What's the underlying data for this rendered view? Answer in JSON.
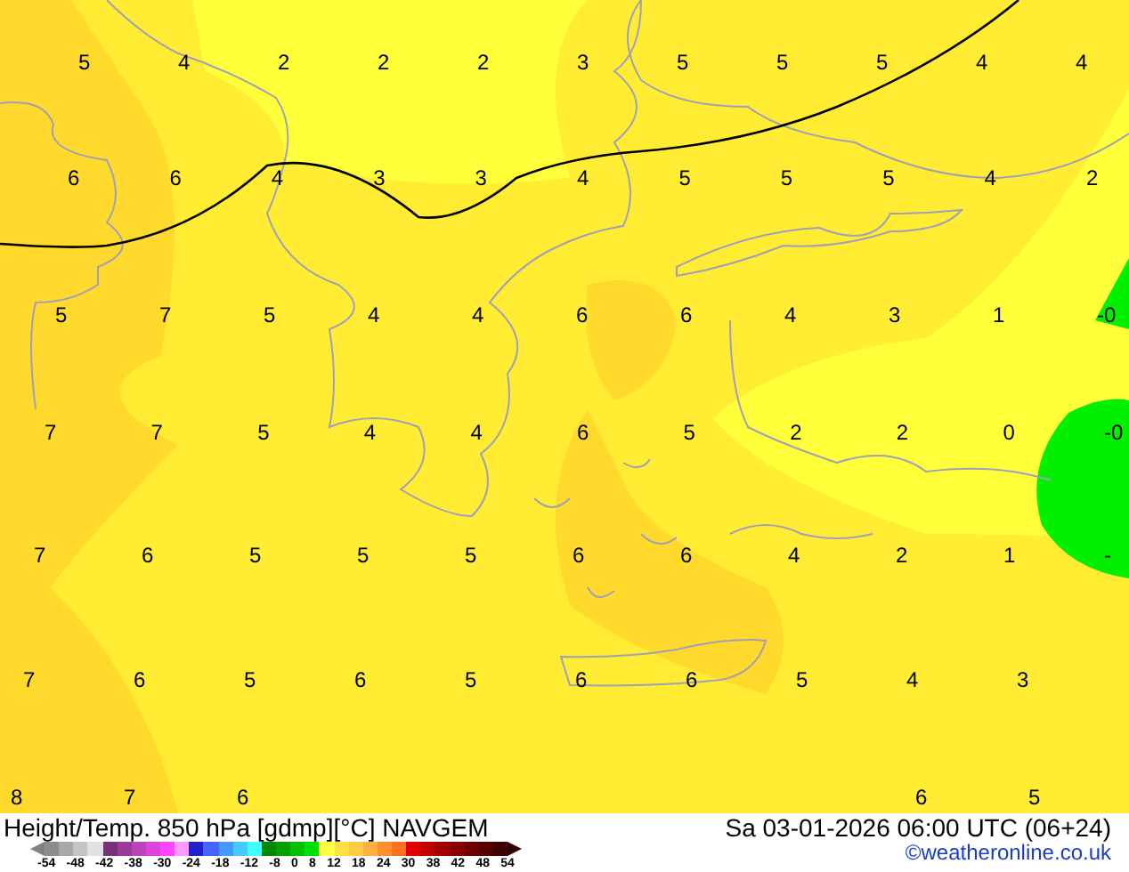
{
  "map": {
    "grid_rows": [
      [
        "5",
        "4",
        "2",
        "2",
        "2",
        "3",
        "5",
        "5",
        "5",
        "4",
        "4"
      ],
      [
        "6",
        "6",
        "4",
        "3",
        "3",
        "4",
        "5",
        "5",
        "5",
        "4",
        "2"
      ],
      [
        "5",
        "7",
        "5",
        "4",
        "4",
        "6",
        "6",
        "4",
        "3",
        "1",
        "-0"
      ],
      [
        "7",
        "7",
        "5",
        "4",
        "4",
        "6",
        "5",
        "2",
        "2",
        "0",
        "-0"
      ],
      [
        "7",
        "6",
        "5",
        "5",
        "5",
        "6",
        "6",
        "4",
        "2",
        "1",
        "-"
      ],
      [
        "7",
        "6",
        "5",
        "6",
        "5",
        "6",
        "6",
        "5",
        "4",
        "3"
      ],
      [
        "8",
        "7",
        "6",
        null,
        null,
        null,
        null,
        null,
        "6",
        "5"
      ]
    ]
  },
  "footer": {
    "title": "Height/Temp. 850 hPa [gdmp][°C] NAVGEM",
    "datetime": "Sa 03-01-2026 06:00 UTC (06+24)",
    "credit": "©weatheronline.co.uk",
    "legend": {
      "swatches": [
        {
          "color": "#8c8c8c"
        },
        {
          "color": "#a8a8a8"
        },
        {
          "color": "#c4c4c4"
        },
        {
          "color": "#e0e0e0"
        },
        {
          "color": "#7a2f7a"
        },
        {
          "color": "#9a3a9a"
        },
        {
          "color": "#bb44bb"
        },
        {
          "color": "#dd44dd"
        },
        {
          "color": "#ff44ff"
        },
        {
          "color": "#ff99ff"
        },
        {
          "color": "#2222cc"
        },
        {
          "color": "#4466ff"
        },
        {
          "color": "#4499ff"
        },
        {
          "color": "#44ccff"
        },
        {
          "color": "#44ffff"
        },
        {
          "color": "#008800"
        },
        {
          "color": "#00a000"
        },
        {
          "color": "#00c000"
        },
        {
          "color": "#00e000"
        },
        {
          "color": "#ffff44"
        },
        {
          "color": "#ffe044"
        },
        {
          "color": "#ffcc44"
        },
        {
          "color": "#ffb040"
        },
        {
          "color": "#ff9030"
        },
        {
          "color": "#ff7020"
        },
        {
          "color": "#e00000"
        },
        {
          "color": "#c00000"
        },
        {
          "color": "#a00000"
        },
        {
          "color": "#880000"
        },
        {
          "color": "#700000"
        },
        {
          "color": "#580000"
        },
        {
          "color": "#400000"
        }
      ],
      "labels": [
        "-54",
        "-48",
        "-42",
        "-38",
        "-30",
        "-24",
        "-18",
        "-12",
        "-8",
        "0",
        "8",
        "12",
        "18",
        "24",
        "30",
        "38",
        "42",
        "48",
        "54"
      ]
    }
  }
}
